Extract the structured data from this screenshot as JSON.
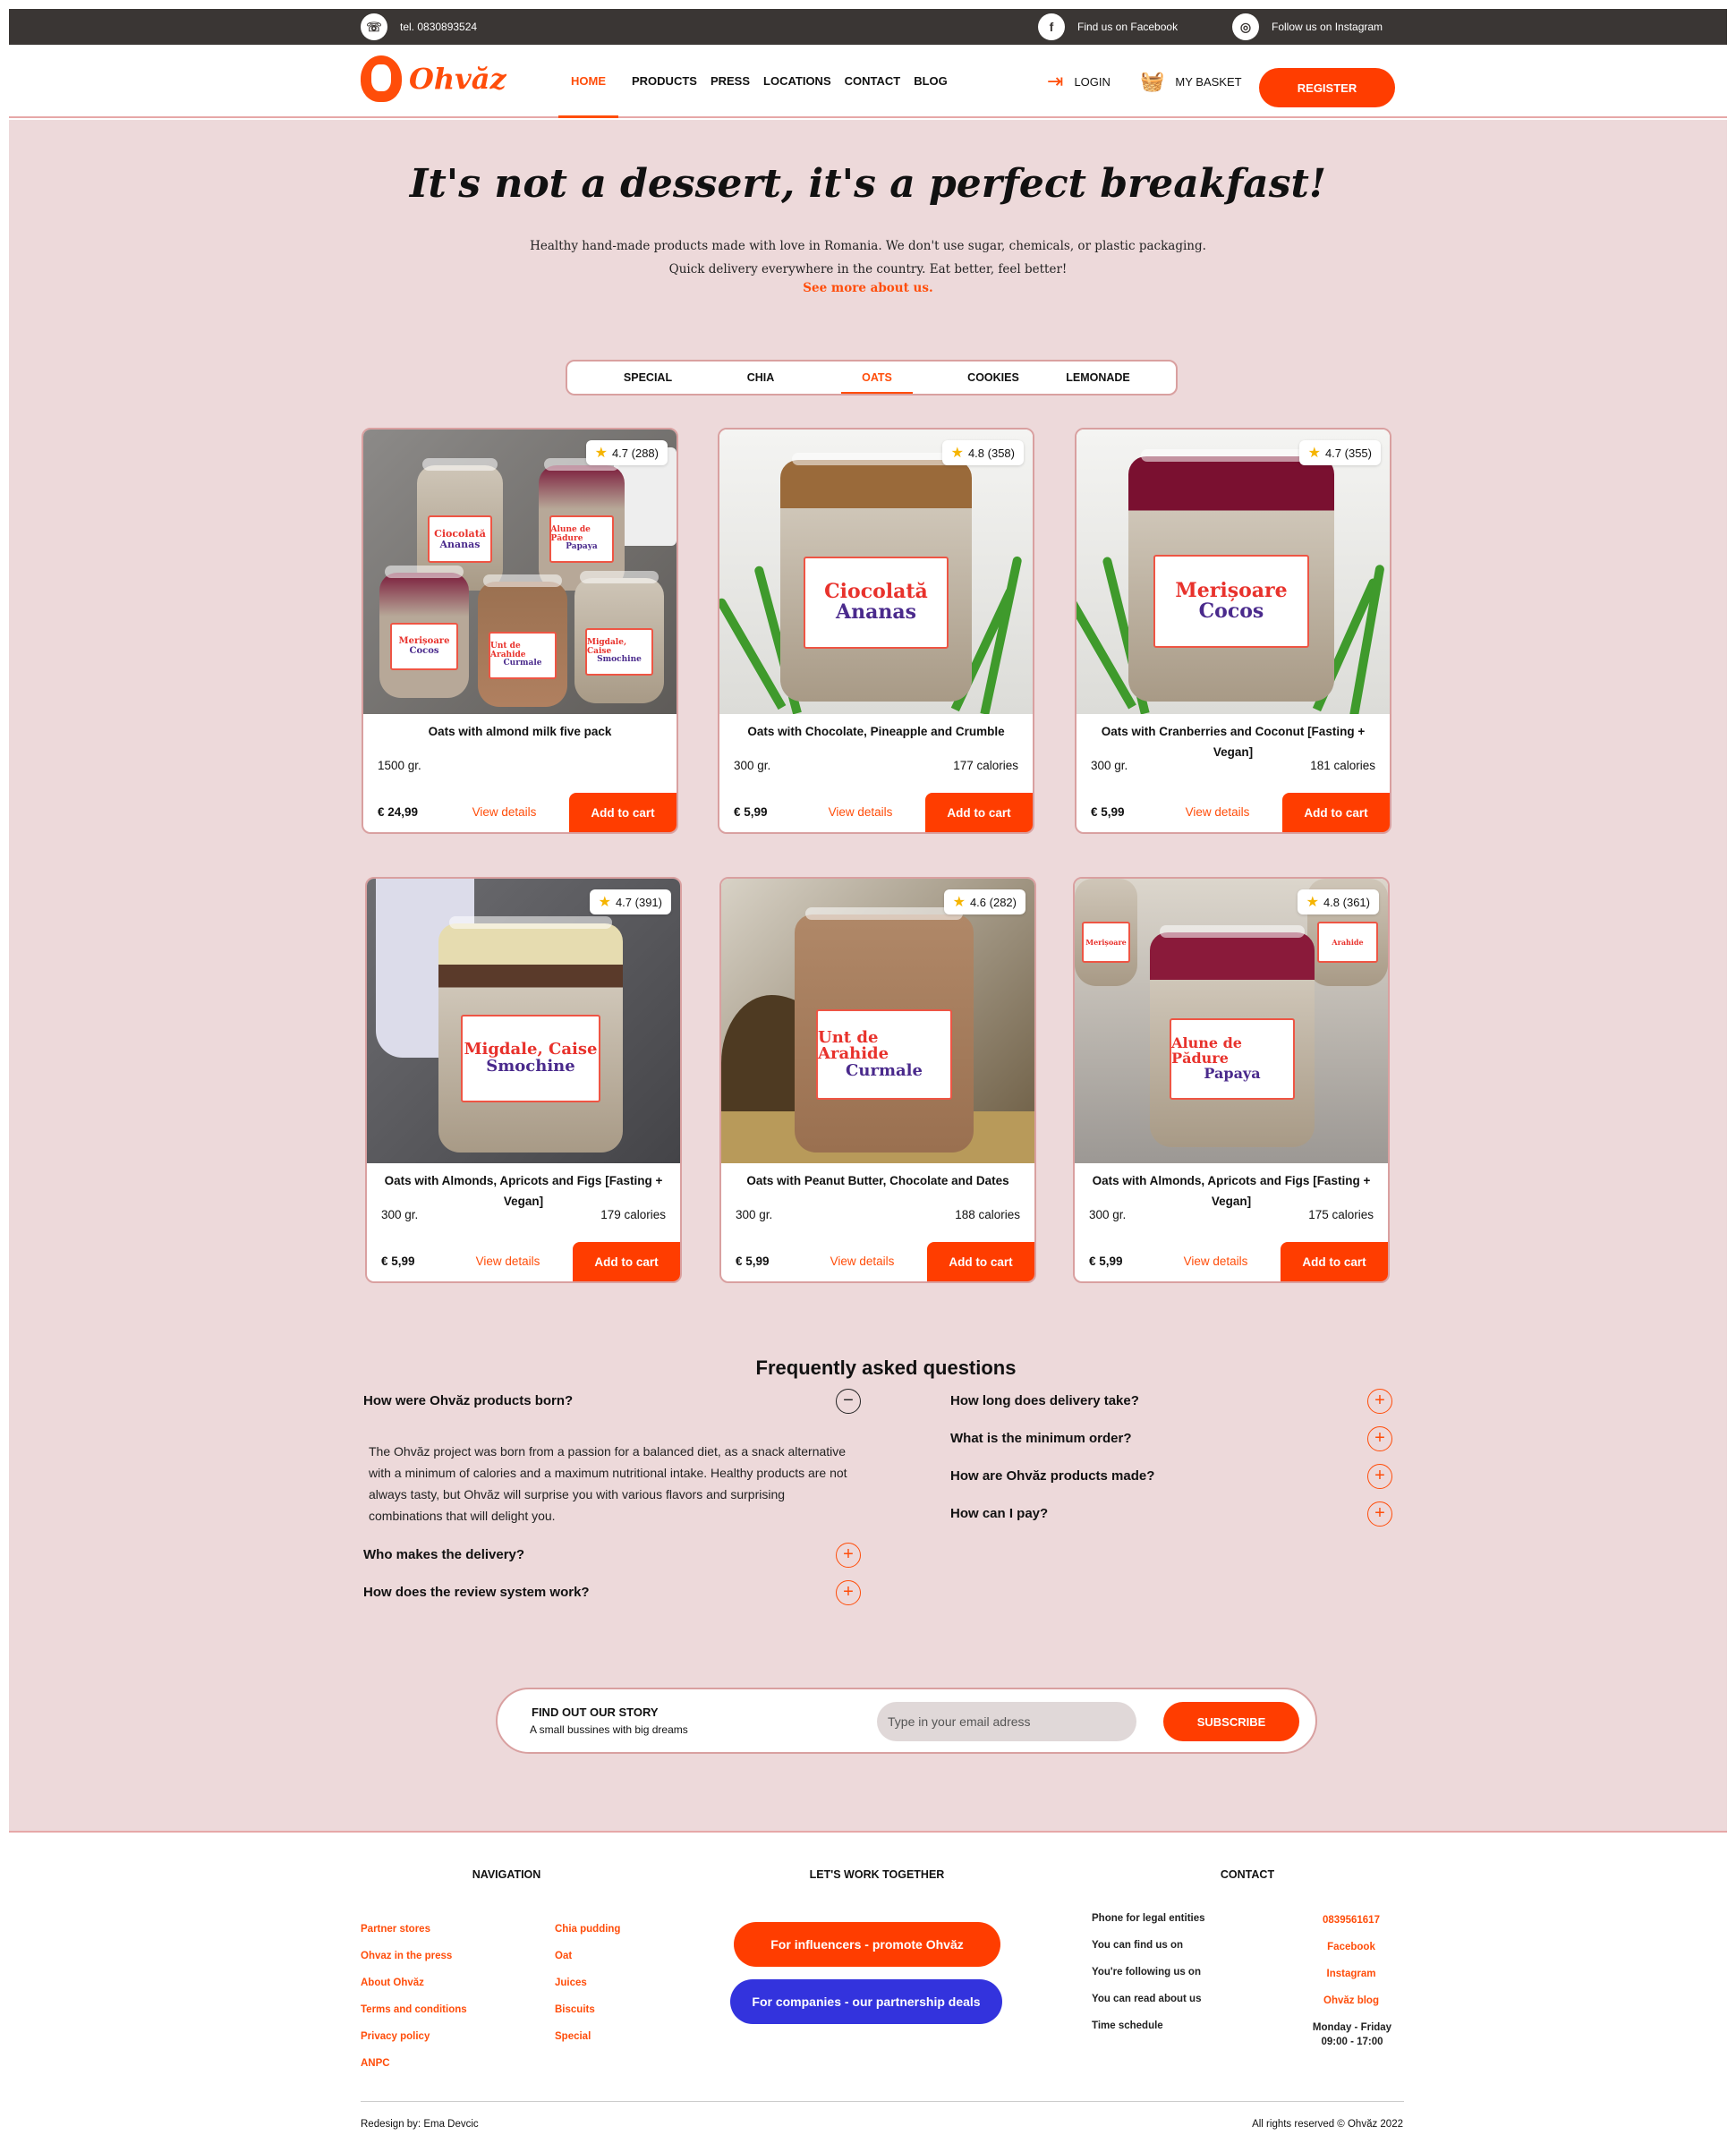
{
  "topbar": {
    "phone": "tel. 0830893524",
    "facebook": "Find us on Facebook",
    "instagram": "Follow us on Instagram",
    "whatsapp_icon": "whatsapp-icon",
    "facebook_icon": "f",
    "instagram_icon": "instagram-icon"
  },
  "header": {
    "logo": "Ohvăz",
    "nav": [
      "HOME",
      "PRODUCTS",
      "PRESS",
      "LOCATIONS",
      "CONTACT",
      "BLOG"
    ],
    "login": "LOGIN",
    "basket": "MY BASKET",
    "register": "REGISTER"
  },
  "hero": {
    "title": "It's not a dessert, it's a perfect breakfast!",
    "line1": "Healthy hand-made products made with love in Romania. We don't use sugar, chemicals, or plastic packaging.",
    "line2": "Quick delivery everywhere in the country. Eat better, feel better!",
    "link": "See more about us."
  },
  "tabs": [
    "SPECIAL",
    "CHIA",
    "OATS",
    "COOKIES",
    "LEMONADE"
  ],
  "active_tab": "OATS",
  "products": [
    {
      "rating": "4.7 (288)",
      "name": "Oats with almond milk five pack",
      "weight": "1500 gr.",
      "calories": "",
      "price": "€ 24,99",
      "details": "View details",
      "cart": "Add to cart"
    },
    {
      "rating": "4.8 (358)",
      "name": "Oats with Chocolate, Pineapple and Crumble",
      "weight": "300 gr.",
      "calories": "177 calories",
      "price": "€ 5,99",
      "details": "View details",
      "cart": "Add to cart",
      "label1": "Ciocolată",
      "label2": "Ananas"
    },
    {
      "rating": "4.7 (355)",
      "name": "Oats with Cranberries and Coconut [Fasting + Vegan]",
      "weight": "300 gr.",
      "calories": "181 calories",
      "price": "€ 5,99",
      "details": "View details",
      "cart": "Add to cart",
      "label1": "Merișoare",
      "label2": "Cocos"
    },
    {
      "rating": "4.7 (391)",
      "name": "Oats with Almonds, Apricots and Figs [Fasting + Vegan]",
      "weight": "300 gr.",
      "calories": "179 calories",
      "price": "€ 5,99",
      "details": "View details",
      "cart": "Add to cart",
      "label1": "Migdale, Caise",
      "label2": "Smochine"
    },
    {
      "rating": "4.6 (282)",
      "name": "Oats with Peanut Butter, Chocolate and Dates",
      "weight": "300 gr.",
      "calories": "188 calories",
      "price": "€ 5,99",
      "details": "View details",
      "cart": "Add to cart",
      "label1": "Unt de Arahide",
      "label2": "Curmale"
    },
    {
      "rating": "4.8 (361)",
      "name": "Oats with Almonds, Apricots and Figs [Fasting + Vegan]",
      "weight": "300 gr.",
      "calories": "175 calories",
      "price": "€ 5,99",
      "details": "View details",
      "cart": "Add to cart",
      "label1": "Alune de Pădure",
      "label2": "Papaya"
    }
  ],
  "faq": {
    "title": "Frequently asked questions",
    "left": [
      {
        "q": "How were Ohvăz products born?",
        "open": true,
        "a": "The Ohvăz project was born from a passion for a balanced diet, as a snack alternative with a minimum of calories and a maximum nutritional intake. Healthy products are not always tasty, but Ohvăz will surprise you with various flavors and surprising combinations that will delight you."
      },
      {
        "q": "Who makes the delivery?",
        "open": false
      },
      {
        "q": "How does the review system work?",
        "open": false
      }
    ],
    "right": [
      {
        "q": "How long does delivery take?",
        "open": false
      },
      {
        "q": "What is the minimum order?",
        "open": false
      },
      {
        "q": "How are Ohvăz products made?",
        "open": false
      },
      {
        "q": "How can I pay?",
        "open": false
      }
    ]
  },
  "subscribe": {
    "title": "FIND OUT OUR STORY",
    "text": "A small bussines with big dreams",
    "placeholder": "Type in your email adress",
    "button": "SUBSCRIBE"
  },
  "footer": {
    "nav_title": "NAVIGATION",
    "nav_col1": [
      "Partner stores",
      "Ohvaz in the press",
      "About Ohvăz",
      "Terms and conditions",
      "Privacy policy",
      "ANPC"
    ],
    "nav_col2": [
      "Chia pudding",
      "Oat",
      "Juices",
      "Biscuits",
      "Special"
    ],
    "work_title": "LET'S WORK TOGETHER",
    "btn_influencers": "For influencers - promote Ohvăz",
    "btn_companies": "For companies - our partnership deals",
    "contact_title": "CONTACT",
    "contact_labels": [
      "Phone for legal entities",
      "You can find us on",
      "You're following us on",
      "You can read about us",
      "Time schedule"
    ],
    "contact_values": [
      "0839561617",
      "Facebook",
      "Instagram",
      "Ohvăz blog"
    ],
    "schedule1": "Monday - Friday",
    "schedule2": "09:00 - 17:00",
    "credit": "Redesign by: Ema Devcic",
    "rights": "All rights reserved © Ohvăz 2022"
  },
  "colors": {
    "accent": "#ff3d00",
    "page_bg": "#edd9da",
    "topbar": "#3a3634",
    "companies_btn": "#3333dd"
  }
}
